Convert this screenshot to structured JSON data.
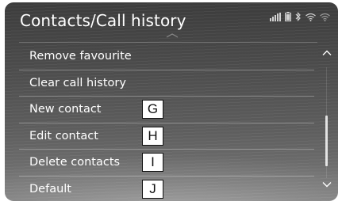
{
  "header": {
    "title": "Contacts/Call history",
    "status_icons": [
      "signal-bars-icon",
      "battery-icon",
      "bluetooth-icon",
      "wifi-icon",
      "wifi-icon"
    ]
  },
  "menu": {
    "items": [
      {
        "label": "Remove favourite",
        "callout": ""
      },
      {
        "label": "Clear call history",
        "callout": ""
      },
      {
        "label": "New contact",
        "callout": "G"
      },
      {
        "label": "Edit contact",
        "callout": "H"
      },
      {
        "label": "Delete contacts",
        "callout": "I"
      },
      {
        "label": "Default",
        "callout": "J"
      }
    ]
  },
  "scrollbar": {
    "up_icon": "chevron-up-icon",
    "down_icon": "chevron-down-icon",
    "position": 0.72
  },
  "colors": {
    "text": "#ffffff",
    "callout_bg": "#ffffff",
    "callout_border": "#111111"
  }
}
